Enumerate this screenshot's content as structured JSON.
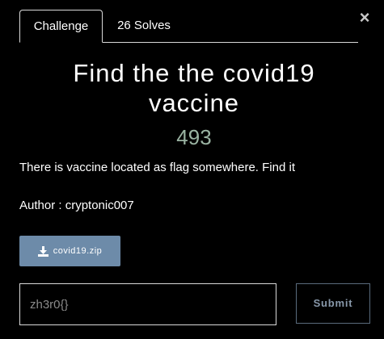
{
  "tabs": [
    {
      "label": "Challenge",
      "active": true
    },
    {
      "label": "26 Solves",
      "active": false
    }
  ],
  "close": {
    "glyph": "×",
    "icon": "close-icon"
  },
  "challenge": {
    "title": "Find the the covid19 vaccine",
    "points": "493",
    "description": "There is vaccine located as flag somewhere. Find it",
    "author": "Author : cryptonic007"
  },
  "file": {
    "label": "covid19.zip",
    "icon": "download-icon"
  },
  "form": {
    "flag_placeholder": "zh3r0{}",
    "submit_label": "Submit"
  },
  "colors": {
    "background": "#000000",
    "points": "#9ab3a2",
    "file_button": "#6d8ba9",
    "submit_border": "#5a6b7d"
  }
}
